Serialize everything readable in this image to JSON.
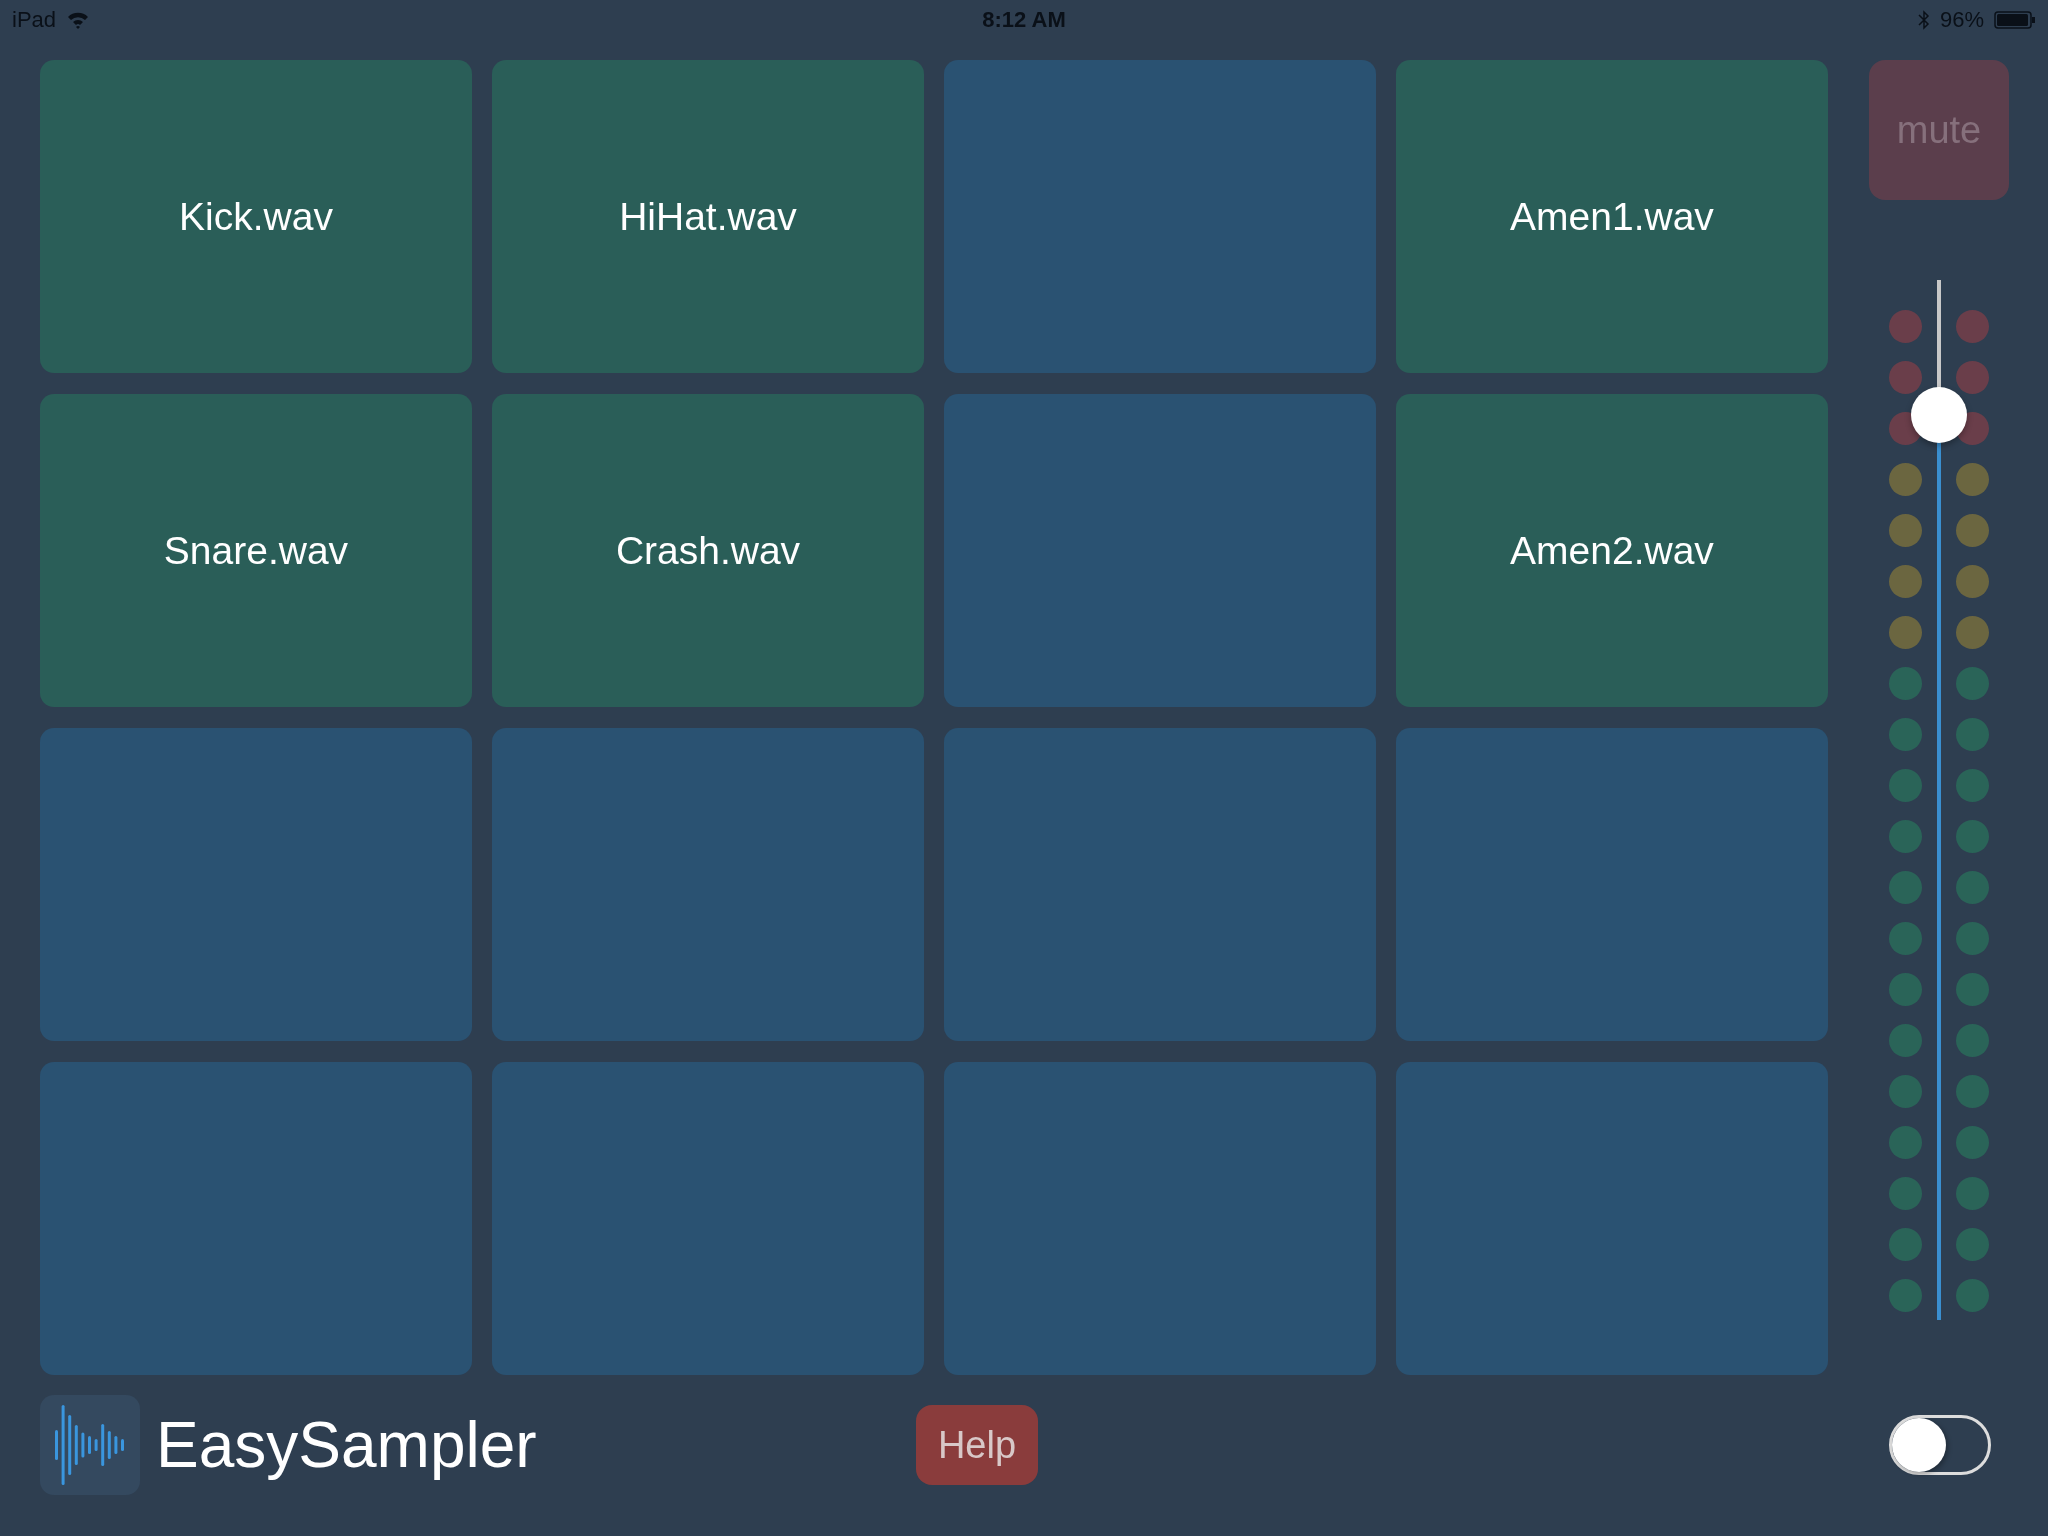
{
  "status_bar": {
    "device": "iPad",
    "time": "8:12 AM",
    "battery": "96%",
    "bluetooth": true,
    "wifi": true
  },
  "pads": [
    {
      "label": "Kick.wav",
      "loaded": true
    },
    {
      "label": "HiHat.wav",
      "loaded": true
    },
    {
      "loaded": false
    },
    {
      "label": "Amen1.wav",
      "loaded": true
    },
    {
      "label": "Snare.wav",
      "loaded": true
    },
    {
      "label": "Crash.wav",
      "loaded": true
    },
    {
      "loaded": false
    },
    {
      "label": "Amen2.wav",
      "loaded": true
    },
    {
      "loaded": false
    },
    {
      "loaded": false
    },
    {
      "loaded": false
    },
    {
      "loaded": false
    },
    {
      "loaded": false
    },
    {
      "loaded": false
    },
    {
      "loaded": false
    },
    {
      "loaded": false
    }
  ],
  "mute": {
    "label": "mute",
    "on": false
  },
  "volume": {
    "level": 0.87
  },
  "meter_rows": [
    {
      "color": "#6a3e4a"
    },
    {
      "color": "#6a3e4a"
    },
    {
      "color": "#6a3e4a"
    },
    {
      "color": "#6b6640"
    },
    {
      "color": "#6b6640"
    },
    {
      "color": "#6b6640"
    },
    {
      "color": "#6b6640"
    },
    {
      "color": "#2a6458"
    },
    {
      "color": "#2a6458"
    },
    {
      "color": "#2a6458"
    },
    {
      "color": "#2a6458"
    },
    {
      "color": "#2a6458"
    },
    {
      "color": "#2a6458"
    },
    {
      "color": "#2a6458"
    },
    {
      "color": "#2a6458"
    },
    {
      "color": "#2a6458"
    },
    {
      "color": "#2a6458"
    },
    {
      "color": "#2a6458"
    },
    {
      "color": "#2a6458"
    },
    {
      "color": "#2a6458"
    }
  ],
  "footer": {
    "app_name": "EasySampler",
    "help": "Help",
    "toggle_on": false
  }
}
